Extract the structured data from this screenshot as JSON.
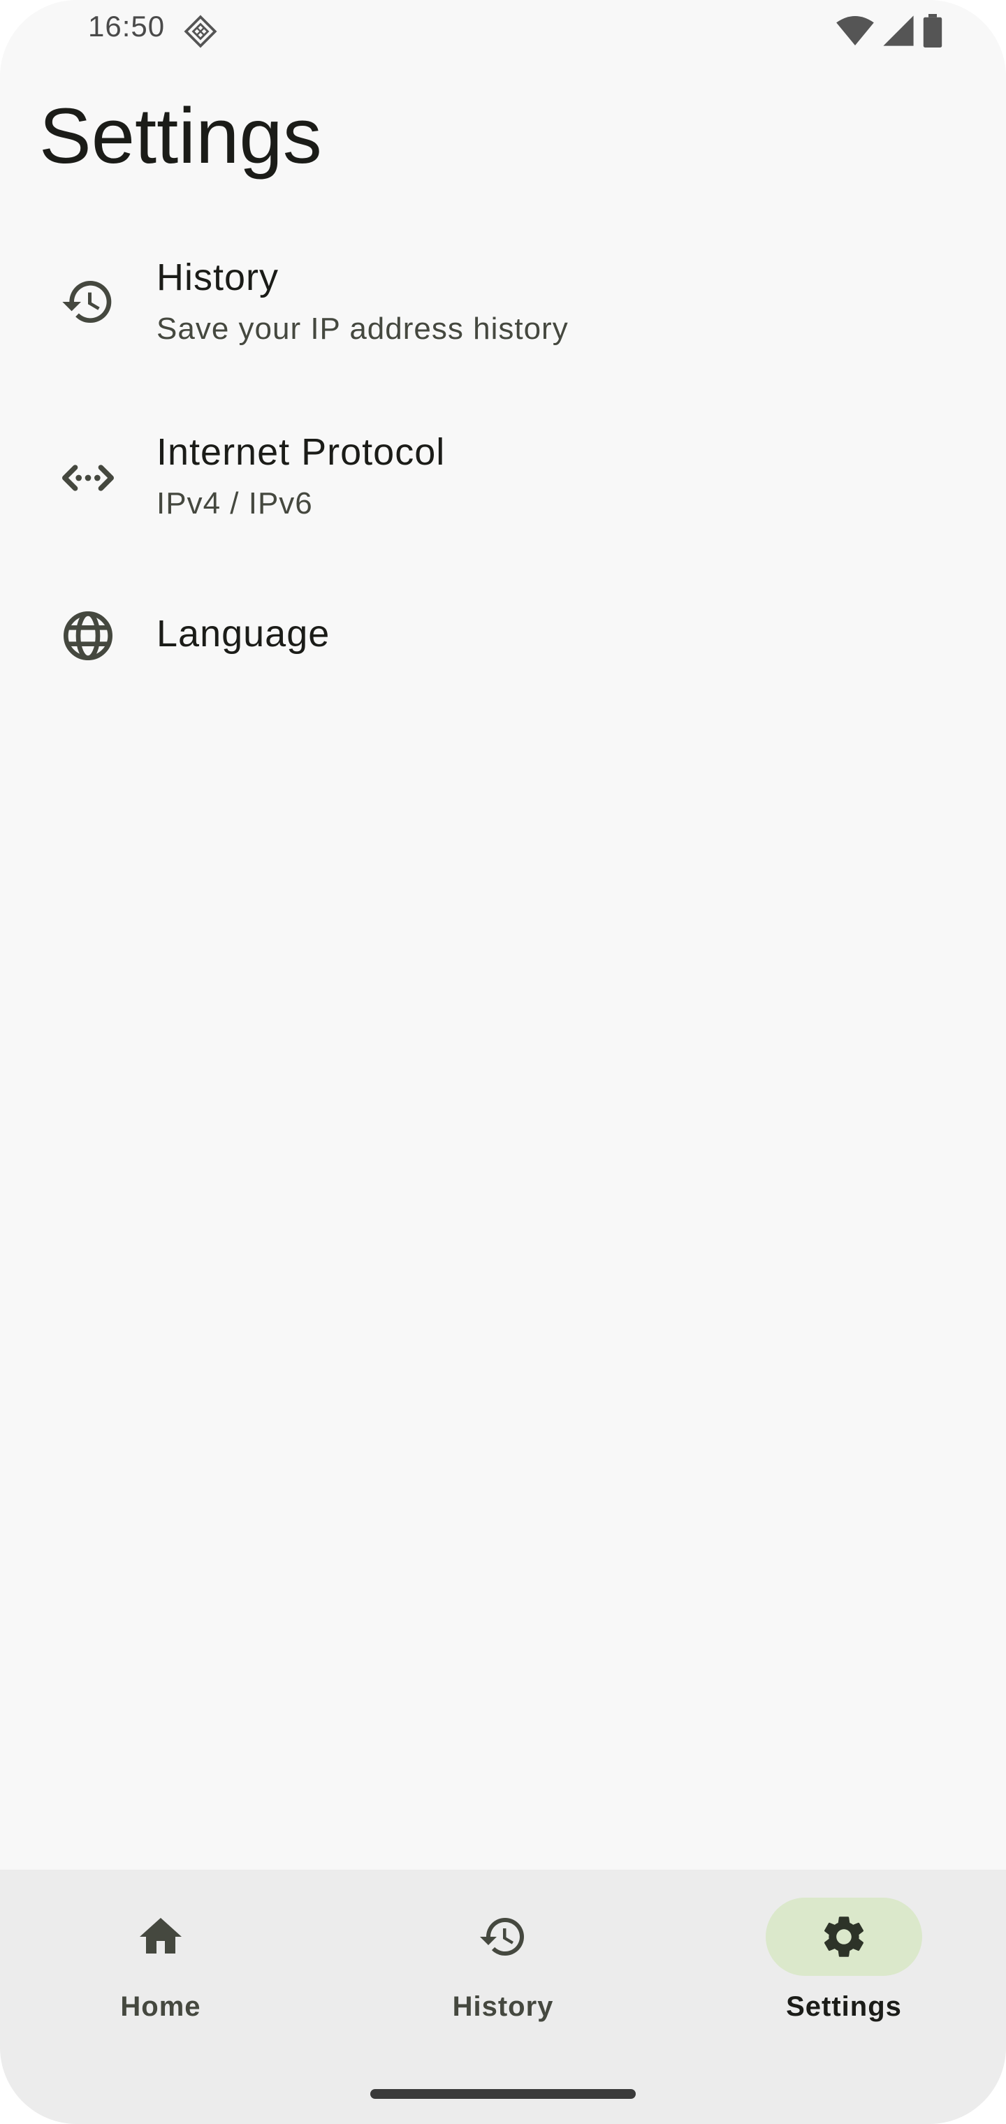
{
  "status_bar": {
    "time": "16:50",
    "app_icon": "diamond-grid-icon",
    "icons": [
      "wifi-icon",
      "signal-icon",
      "battery-icon"
    ]
  },
  "page": {
    "title": "Settings"
  },
  "settings": {
    "items": [
      {
        "icon": "history-icon",
        "title": "History",
        "subtitle": "Save your IP address history"
      },
      {
        "icon": "code-arrows-icon",
        "title": "Internet Protocol",
        "subtitle": "IPv4 / IPv6"
      },
      {
        "icon": "globe-icon",
        "title": "Language"
      }
    ]
  },
  "bottom_nav": {
    "items": [
      {
        "icon": "home-icon",
        "label": "Home",
        "active": false
      },
      {
        "icon": "history-icon",
        "label": "History",
        "active": false
      },
      {
        "icon": "gear-icon",
        "label": "Settings",
        "active": true
      }
    ],
    "active_pill_color": "#dbe8cb"
  },
  "colors": {
    "background": "#f8f8f8",
    "nav_background": "#ececec",
    "text_primary": "#1b1c18",
    "text_secondary": "#45483f"
  }
}
